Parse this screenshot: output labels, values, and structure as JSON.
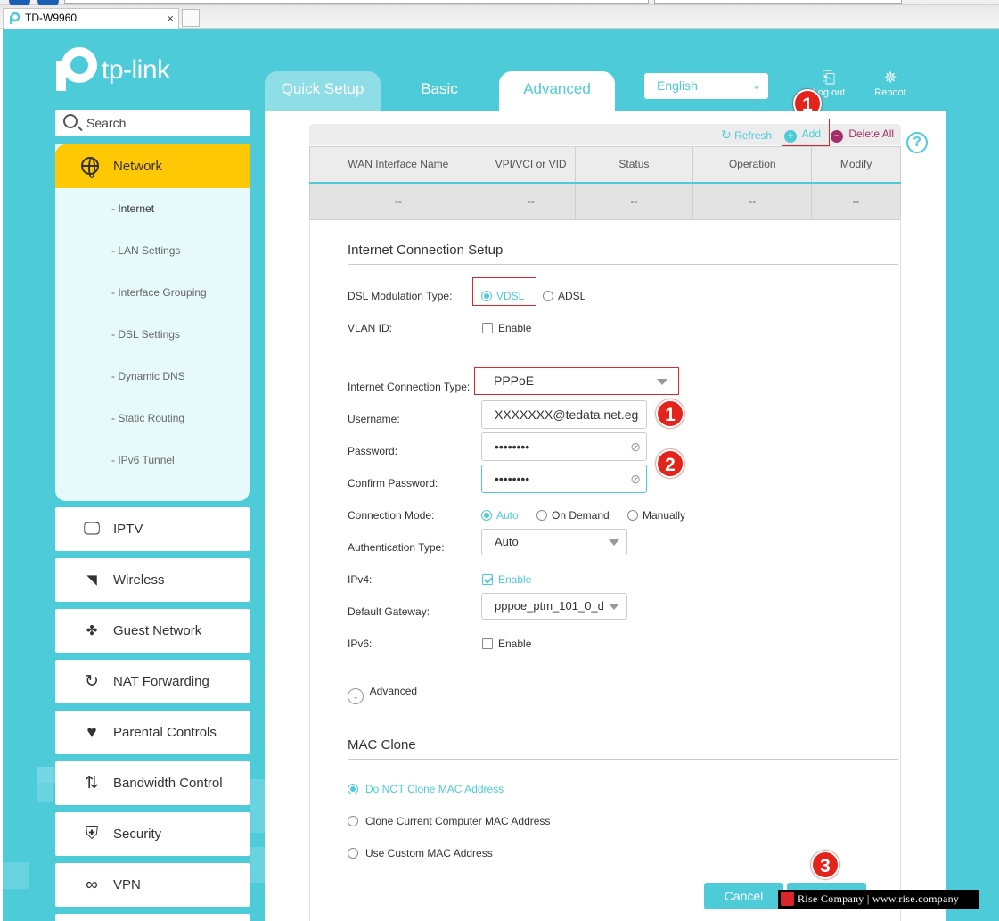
{
  "browser": {
    "tab_title": "TD-W9960",
    "tab_close": "×"
  },
  "header": {
    "logo_text": "tp-link",
    "tabs": [
      {
        "label": "Quick Setup"
      },
      {
        "label": "Basic"
      },
      {
        "label": "Advanced"
      }
    ],
    "language": "English",
    "logout_label": "Log out",
    "reboot_label": "Reboot"
  },
  "sidebar": {
    "search_placeholder": "Search",
    "network_label": "Network",
    "network_subitems": [
      {
        "label": "- Internet"
      },
      {
        "label": "- LAN Settings"
      },
      {
        "label": "- Interface Grouping"
      },
      {
        "label": "- DSL Settings"
      },
      {
        "label": "- Dynamic DNS"
      },
      {
        "label": "- Static Routing"
      },
      {
        "label": "- IPv6 Tunnel"
      }
    ],
    "items": [
      {
        "label": "IPTV",
        "icon": "monitor-icon"
      },
      {
        "label": "Wireless",
        "icon": "wifi-icon"
      },
      {
        "label": "Guest Network",
        "icon": "guest-icon"
      },
      {
        "label": "NAT Forwarding",
        "icon": "nat-icon"
      },
      {
        "label": "Parental Controls",
        "icon": "heart-icon"
      },
      {
        "label": "Bandwidth Control",
        "icon": "bandwidth-icon"
      },
      {
        "label": "Security",
        "icon": "shield-icon"
      },
      {
        "label": "VPN",
        "icon": "link-icon"
      }
    ]
  },
  "toolbar": {
    "refresh": "Refresh",
    "add": "Add",
    "delete_all": "Delete All",
    "help": "?"
  },
  "wan_table": {
    "headers": [
      "WAN Interface Name",
      "VPI/VCI or VID",
      "Status",
      "Operation",
      "Modify"
    ],
    "row": [
      "--",
      "--",
      "--",
      "--",
      "--"
    ]
  },
  "form": {
    "section_title": "Internet Connection Setup",
    "dsl_label": "DSL Modulation Type:",
    "dsl_options": [
      "VDSL",
      "ADSL"
    ],
    "vlan_label": "VLAN ID:",
    "enable": "Enable",
    "conn_type_label": "Internet Connection Type:",
    "conn_type_value": "PPPoE",
    "username_label": "Username:",
    "username_value": "XXXXXXX@tedata.net.eg",
    "password_label": "Password:",
    "password_value": "••••••••",
    "confirm_label": "Confirm Password:",
    "confirm_value": "••••••••",
    "mode_label": "Connection Mode:",
    "mode_options": [
      "Auto",
      "On Demand",
      "Manually"
    ],
    "auth_label": "Authentication Type:",
    "auth_value": "Auto",
    "ipv4_label": "IPv4:",
    "gateway_label": "Default Gateway:",
    "gateway_value": "pppoe_ptm_101_0_d",
    "ipv6_label": "IPv6:",
    "advanced_label": "Advanced"
  },
  "mac_clone": {
    "title": "MAC Clone",
    "options": [
      "Do NOT Clone MAC Address",
      "Clone Current Computer MAC Address",
      "Use Custom MAC Address"
    ]
  },
  "actions": {
    "cancel": "Cancel"
  },
  "annotations": {
    "badge_add": "1",
    "badge_username": "1",
    "badge_password": "2",
    "badge_save": "3"
  },
  "watermark": "Rise Company | www.rise.company",
  "colors": {
    "accent": "#4ecbd9",
    "network_highlight": "#ffc805",
    "annotation_red": "#e4231b"
  }
}
